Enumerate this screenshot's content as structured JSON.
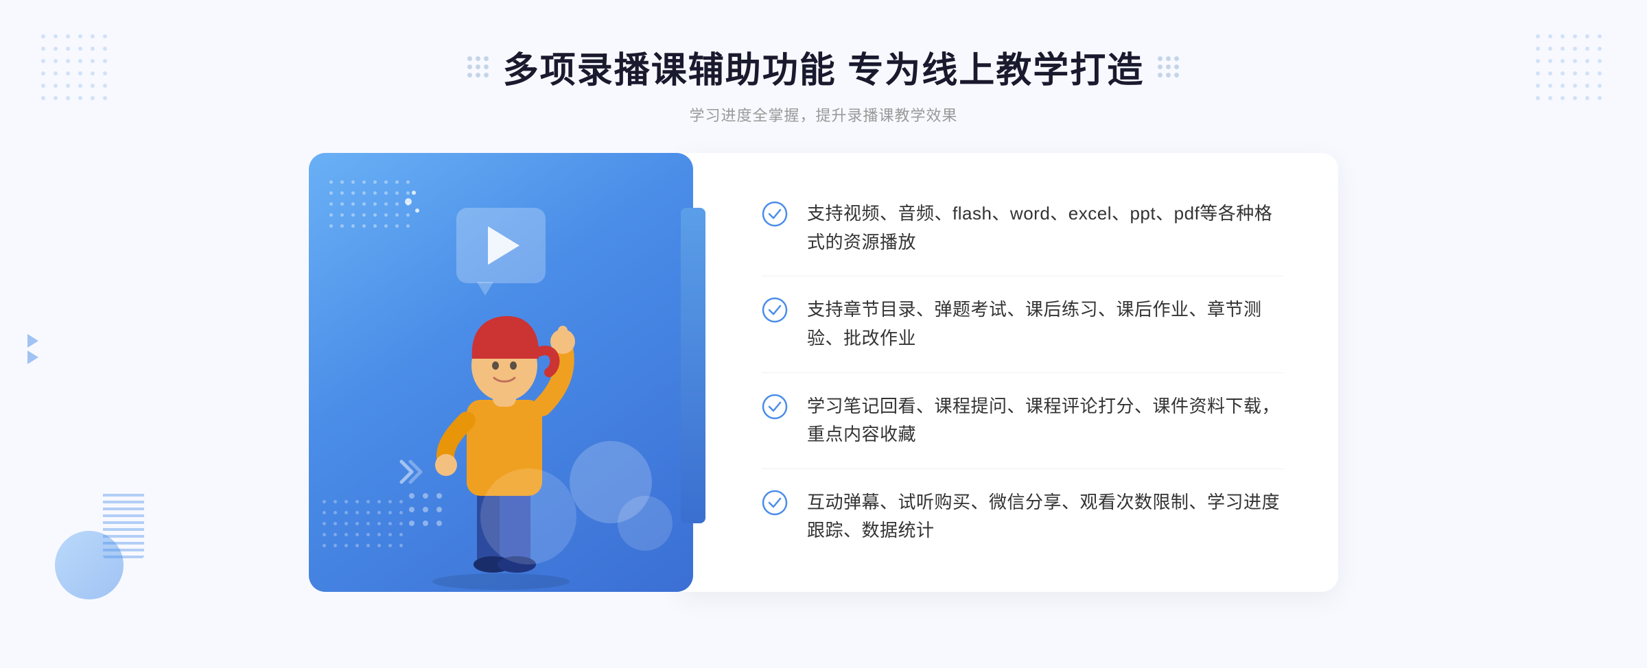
{
  "page": {
    "background_color": "#f5f7ff"
  },
  "header": {
    "title": "多项录播课辅助功能 专为线上教学打造",
    "subtitle": "学习进度全掌握，提升录播课教学效果"
  },
  "features": [
    {
      "id": 1,
      "text": "支持视频、音频、flash、word、excel、ppt、pdf等各种格式的资源播放"
    },
    {
      "id": 2,
      "text": "支持章节目录、弹题考试、课后练习、课后作业、章节测验、批改作业"
    },
    {
      "id": 3,
      "text": "学习笔记回看、课程提问、课程评论打分、课件资料下载，重点内容收藏"
    },
    {
      "id": 4,
      "text": "互动弹幕、试听购买、微信分享、观看次数限制、学习进度跟踪、数据统计"
    }
  ],
  "icons": {
    "check_color": "#4a8de8",
    "title_dot_color": "#c5d5e8",
    "chevron_color": "#4a8de8"
  }
}
